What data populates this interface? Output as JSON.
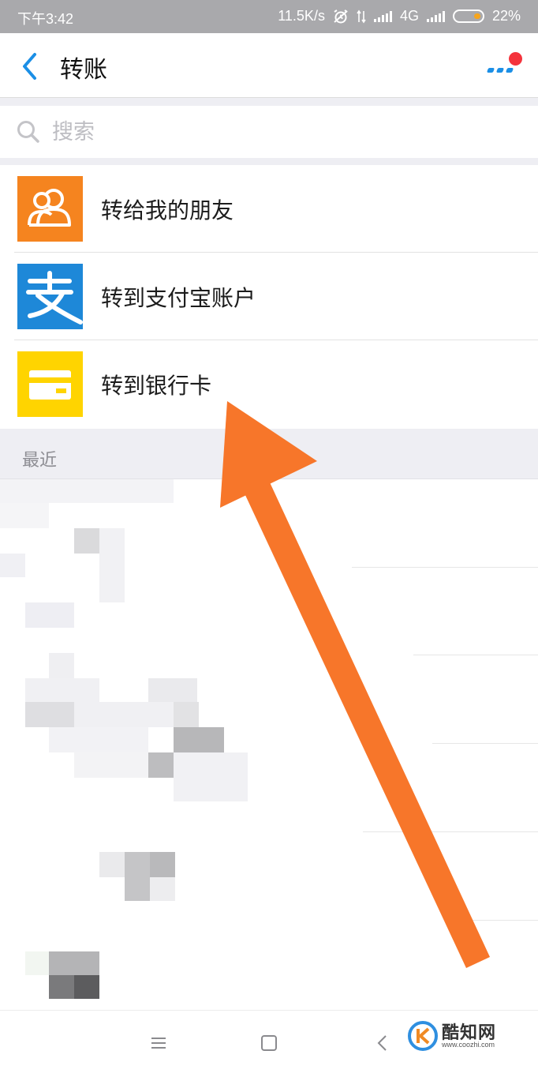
{
  "status_bar": {
    "time": "下午3:42",
    "network_speed": "11.5K/s",
    "network_type": "4G",
    "battery": "22%"
  },
  "header": {
    "title": "转账",
    "back_icon": "chevron-left-icon",
    "more_icon": "more-icon",
    "has_notification_dot": true
  },
  "search": {
    "placeholder": "搜索"
  },
  "menu": {
    "items": [
      {
        "label": "转给我的朋友",
        "icon": "friends-icon",
        "color": "#F5841F"
      },
      {
        "label": "转到支付宝账户",
        "icon": "alipay-icon",
        "color": "#1E88D8"
      },
      {
        "label": "转到银行卡",
        "icon": "bank-card-icon",
        "color": "#FFD400"
      }
    ]
  },
  "recent": {
    "header": "最近"
  },
  "nav": {
    "buttons": [
      "menu-icon",
      "home-icon",
      "back-icon"
    ]
  },
  "watermark": {
    "brand": "酷知网",
    "site": "www.coozhi.com"
  },
  "colors": {
    "accent": "#1B8FE6",
    "arrow": "#F7762A",
    "status_bar": "#A9A9AC",
    "section_bg": "#EEEEF3"
  }
}
